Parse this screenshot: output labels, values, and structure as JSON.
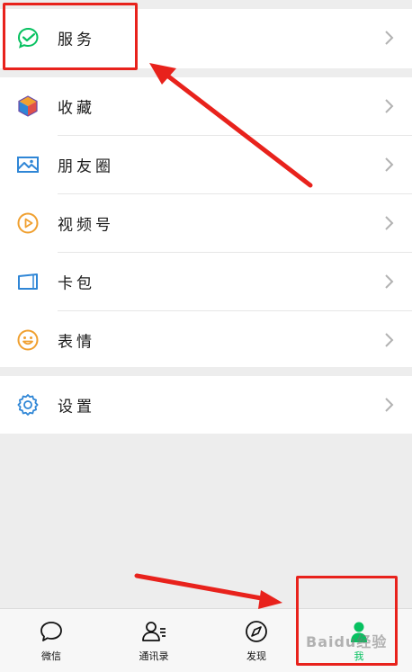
{
  "menu": {
    "services": "服务",
    "favorites": "收藏",
    "moments": "朋友圈",
    "channels": "视频号",
    "card_wallet": "卡包",
    "stickers": "表情",
    "settings": "设置"
  },
  "tabs": {
    "chats": "微信",
    "contacts": "通讯录",
    "discover": "发现",
    "me": "我"
  },
  "watermark": "Baidu经验",
  "colors": {
    "accent_green": "#07c160",
    "annotation_red": "#e8221c"
  }
}
